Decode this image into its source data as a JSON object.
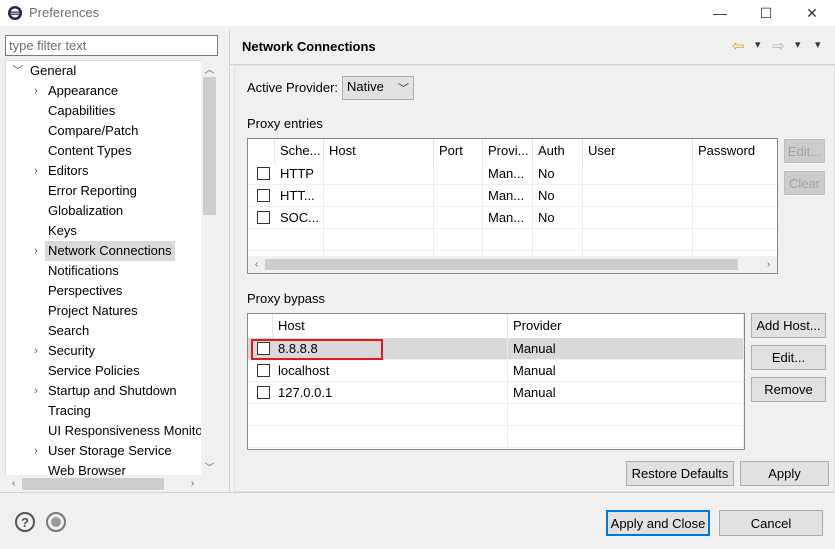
{
  "window": {
    "title": "Preferences",
    "minimize_glyph": "—",
    "maximize_glyph": "☐",
    "close_glyph": "✕"
  },
  "filter": {
    "placeholder": "type filter text",
    "value": ""
  },
  "tree": {
    "items": [
      {
        "label": "General",
        "arrow": "﹀",
        "level": 0,
        "selected": false
      },
      {
        "label": "Appearance",
        "arrow": "›",
        "level": 1,
        "selected": false
      },
      {
        "label": "Capabilities",
        "arrow": "",
        "level": 1,
        "selected": false
      },
      {
        "label": "Compare/Patch",
        "arrow": "",
        "level": 1,
        "selected": false
      },
      {
        "label": "Content Types",
        "arrow": "",
        "level": 1,
        "selected": false
      },
      {
        "label": "Editors",
        "arrow": "›",
        "level": 1,
        "selected": false
      },
      {
        "label": "Error Reporting",
        "arrow": "",
        "level": 1,
        "selected": false
      },
      {
        "label": "Globalization",
        "arrow": "",
        "level": 1,
        "selected": false
      },
      {
        "label": "Keys",
        "arrow": "",
        "level": 1,
        "selected": false
      },
      {
        "label": "Network Connections",
        "arrow": "›",
        "level": 1,
        "selected": true
      },
      {
        "label": "Notifications",
        "arrow": "",
        "level": 1,
        "selected": false
      },
      {
        "label": "Perspectives",
        "arrow": "",
        "level": 1,
        "selected": false
      },
      {
        "label": "Project Natures",
        "arrow": "",
        "level": 1,
        "selected": false
      },
      {
        "label": "Search",
        "arrow": "",
        "level": 1,
        "selected": false
      },
      {
        "label": "Security",
        "arrow": "›",
        "level": 1,
        "selected": false
      },
      {
        "label": "Service Policies",
        "arrow": "",
        "level": 1,
        "selected": false
      },
      {
        "label": "Startup and Shutdown",
        "arrow": "›",
        "level": 1,
        "selected": false
      },
      {
        "label": "Tracing",
        "arrow": "",
        "level": 1,
        "selected": false
      },
      {
        "label": "UI Responsiveness Monito",
        "arrow": "",
        "level": 1,
        "selected": false
      },
      {
        "label": "User Storage Service",
        "arrow": "›",
        "level": 1,
        "selected": false
      },
      {
        "label": "Web Browser",
        "arrow": "",
        "level": 1,
        "selected": false
      }
    ]
  },
  "page": {
    "title": "Network Connections",
    "nav": {
      "back_glyph": "⇦",
      "forward_glyph": "⇨",
      "menu_glyph": "▾",
      "dropdown_glyph": "▾"
    },
    "active_provider": {
      "label": "Active Provider:",
      "value": "Native"
    },
    "proxy_entries": {
      "label": "Proxy entries",
      "columns": [
        "Sche...",
        "Host",
        "Port",
        "Provi...",
        "Auth",
        "User",
        "Password"
      ],
      "rows": [
        {
          "checked": false,
          "cells": [
            "HTTP",
            "",
            "",
            "Man...",
            "No",
            "",
            ""
          ]
        },
        {
          "checked": false,
          "cells": [
            "HTT...",
            "",
            "",
            "Man...",
            "No",
            "",
            ""
          ]
        },
        {
          "checked": false,
          "cells": [
            "SOC...",
            "",
            "",
            "Man...",
            "No",
            "",
            ""
          ]
        }
      ],
      "edit_label": "Edit...",
      "clear_label": "Clear"
    },
    "proxy_bypass": {
      "label": "Proxy bypass",
      "columns": [
        "Host",
        "Provider"
      ],
      "rows": [
        {
          "checked": false,
          "cells": [
            "8.8.8.8",
            "Manual"
          ],
          "selected": true
        },
        {
          "checked": false,
          "cells": [
            "localhost",
            "Manual"
          ],
          "selected": false
        },
        {
          "checked": false,
          "cells": [
            "127.0.0.1",
            "Manual"
          ],
          "selected": false
        }
      ],
      "add_host_label": "Add Host...",
      "edit_label": "Edit...",
      "remove_label": "Remove"
    },
    "restore_defaults_label": "Restore Defaults",
    "apply_label": "Apply"
  },
  "footer": {
    "help_glyph": "?",
    "apply_close_label": "Apply and Close",
    "cancel_label": "Cancel"
  },
  "colors": {
    "highlight_box": "#e0191f",
    "selection": "#d9d9d9",
    "default_button_border": "#0078d7"
  }
}
